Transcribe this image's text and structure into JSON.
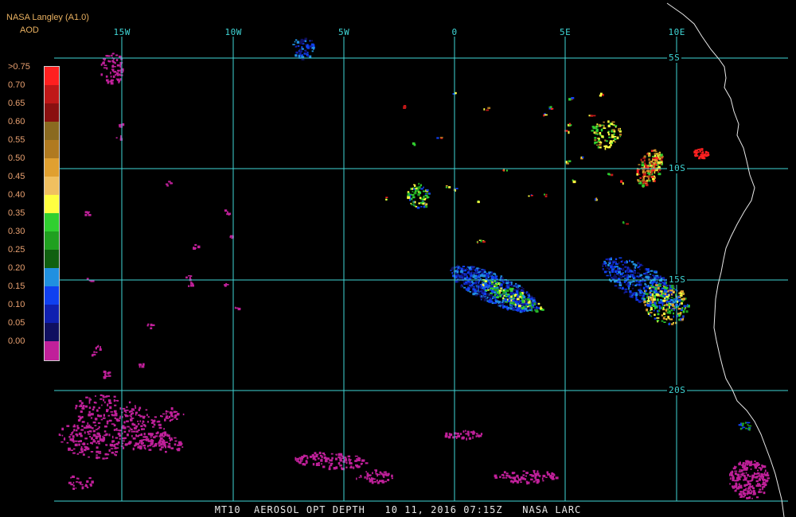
{
  "header": {
    "source": "NASA Langley (A1.0)",
    "variable": "AOD"
  },
  "legend": {
    "labels": [
      ">0.75",
      "0.70",
      "0.65",
      "0.60",
      "0.55",
      "0.50",
      "0.45",
      "0.40",
      "0.35",
      "0.30",
      "0.25",
      "0.20",
      "0.15",
      "0.10",
      "0.05",
      "0.00"
    ],
    "colors": [
      "#ff2020",
      "#c01818",
      "#8a1010",
      "#8a6a20",
      "#b07a20",
      "#e0a030",
      "#f0c060",
      "#ffff40",
      "#30d030",
      "#20a020",
      "#106010",
      "#2090e0",
      "#1040f0",
      "#1020b0",
      "#101060",
      "#c0209a"
    ]
  },
  "grid": {
    "lon_labels": [
      "15W",
      "10W",
      "5W",
      "0",
      "5E",
      "10E"
    ],
    "lat_labels": [
      "5S",
      "10S",
      "15S",
      "20S"
    ]
  },
  "footer": "MT10  AEROSOL OPT DEPTH   10 11, 2016 07:15Z   NASA LARC",
  "theme": {
    "grid": "#3fd6d6",
    "coast": "#e8e8e8",
    "bg": "#000000"
  }
}
